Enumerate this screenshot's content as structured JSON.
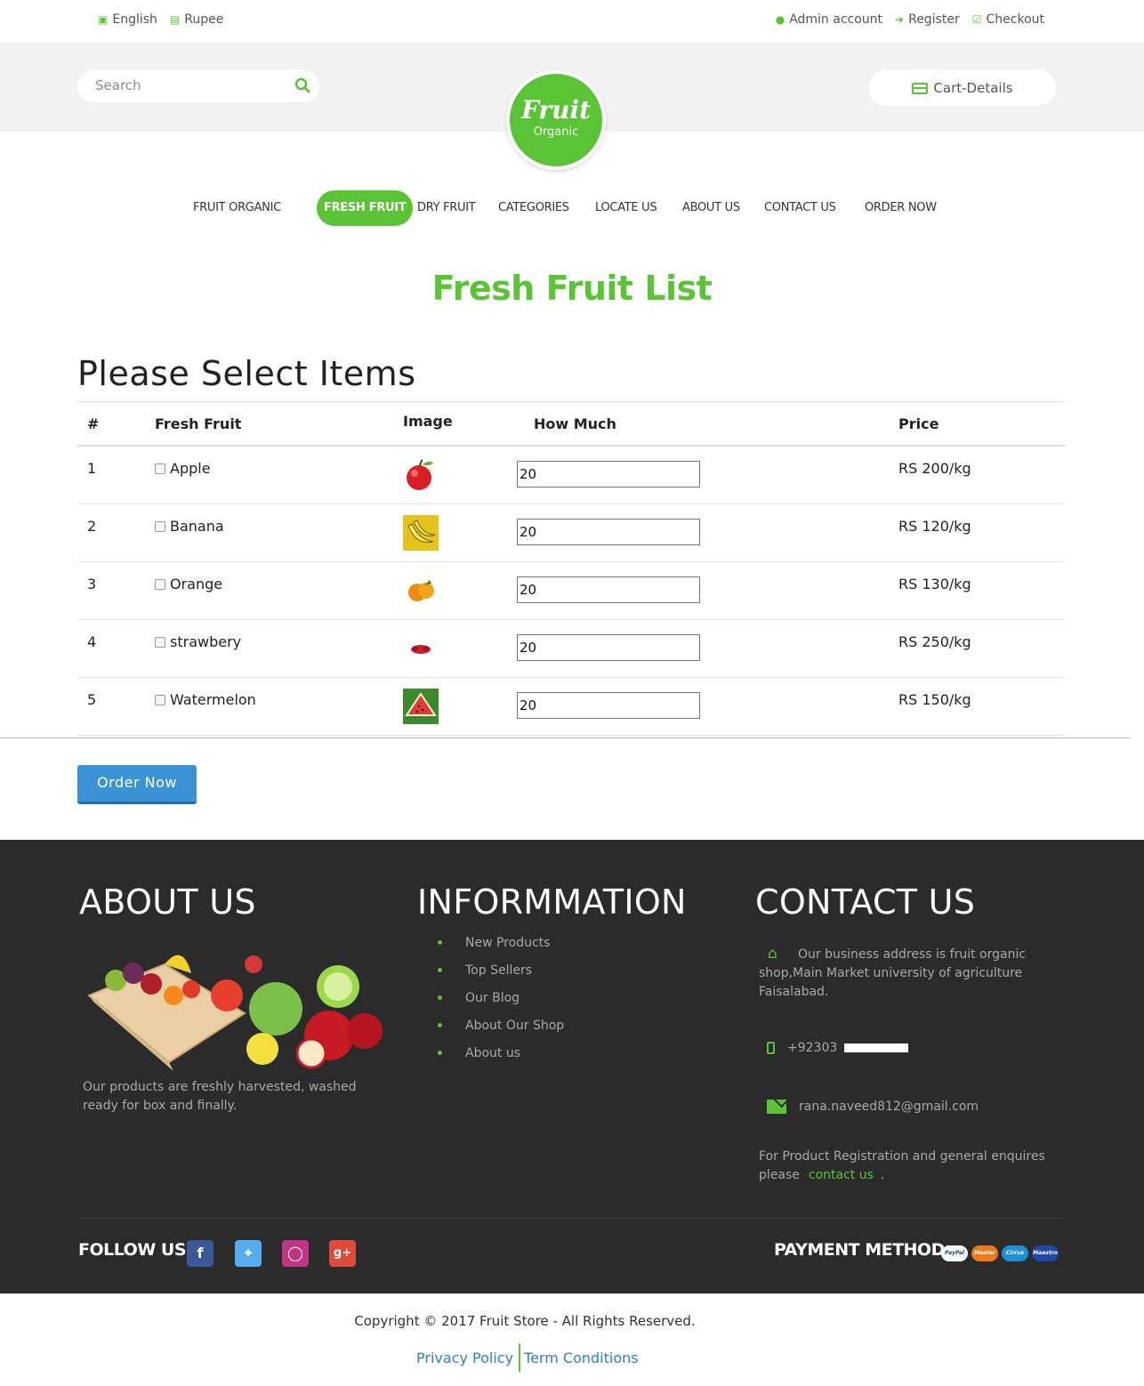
{
  "topbar": {
    "language": "English",
    "currency": "Rupee",
    "admin": "Admin account",
    "register": "Register",
    "checkout": "Checkout"
  },
  "header": {
    "search_placeholder": "Search",
    "cart_label": "Cart-Details",
    "logo_line1": "Fruit",
    "logo_line2": "Organic"
  },
  "nav": {
    "items": [
      "FRUIT ORGANIC",
      "FRESH FRUIT",
      "DRY FRUIT",
      "CATEGORIES",
      "LOCATE US",
      "ABOUT US",
      "CONTACT US",
      "ORDER NOW"
    ],
    "active": "FRESH FRUIT"
  },
  "page_title": "Fresh Fruit List",
  "section_title": "Please Select Items",
  "table": {
    "headers": [
      "#",
      "Fresh Fruit",
      "Image",
      "How Much",
      "Price"
    ],
    "rows": [
      {
        "num": "1",
        "fruit": "Apple",
        "qty": "20",
        "price": "RS 200/kg",
        "icon": "apple-image"
      },
      {
        "num": "2",
        "fruit": "Banana",
        "qty": "20",
        "price": "RS 120/kg",
        "icon": "banana-image"
      },
      {
        "num": "3",
        "fruit": "Orange",
        "qty": "20",
        "price": "RS 130/kg",
        "icon": "orange-image"
      },
      {
        "num": "4",
        "fruit": "strawbery",
        "qty": "20",
        "price": "RS 250/kg",
        "icon": "strawberry-image"
      },
      {
        "num": "5",
        "fruit": "Watermelon",
        "qty": "20",
        "price": "RS 150/kg",
        "icon": "watermelon-image"
      }
    ]
  },
  "order_button": "Order Now",
  "footer": {
    "about_title": "ABOUT US",
    "about_text": "Our products are freshly harvested, washed ready for box and finally.",
    "info_title": "INFORMMATION",
    "info_items": [
      "New Products",
      "Top Sellers",
      "Our Blog",
      "About Our Shop",
      "About us"
    ],
    "contact_title": "CONTACT US",
    "address": "Our business address is fruit organic shop,Main Market university of agriculture Faisalabad.",
    "phone": "+92303",
    "email": "rana.naveed812@gmail.com",
    "enquiry_text": "For Product Registration and general enquires please",
    "contact_link": "contact us",
    "enquiry_end": ".",
    "follow_label": "FOLLOW US",
    "payment_label": "PAYMENT METHOD",
    "payment_methods": [
      "PayPal",
      "MasterCard",
      "Cirrus",
      "Maestro"
    ]
  },
  "copyright": "Copyright © 2017 Fruit Store - All Rights Reserved.",
  "links": {
    "privacy": "Privacy Policy",
    "terms": "Term Conditions"
  },
  "colors": {
    "brand_green": "#5ac336",
    "button_blue": "#3b93d6",
    "footer_bg": "#2b2b2b"
  }
}
